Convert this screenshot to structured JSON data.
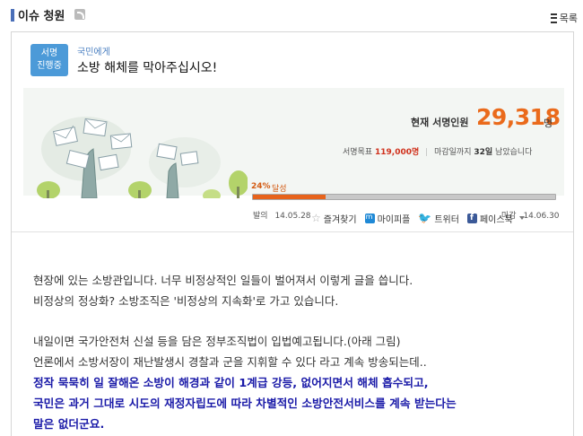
{
  "header": {
    "title": "이슈 청원",
    "rss_icon": "rss-icon",
    "list_label": "목록"
  },
  "petition": {
    "status_line1": "서명",
    "status_line2": "진행중",
    "to": "국민에게",
    "title": "소방 해체를 막아주십시오!"
  },
  "stats": {
    "current_label": "현재 서명인원",
    "current_count": "29,318",
    "current_unit": "명",
    "goal_label": "서명목표",
    "goal_value": "119,000명",
    "deadline_label": "마감일까지",
    "deadline_days": "32일",
    "deadline_suffix": "남았습니다",
    "progress_text": "24%",
    "progress_suffix": "달성",
    "progress_value": 24,
    "start_label": "발의",
    "start_date": "14.05.28",
    "end_label": "마감",
    "end_date": "14.06.30",
    "accent_color": "#e7631b"
  },
  "share": {
    "bookmark": "즐겨찾기",
    "me2day": "마이피플",
    "twitter": "트위터",
    "facebook": "페이스북"
  },
  "content": {
    "lines": [
      "현장에 있는 소방관입니다. 너무 비정상적인 일들이 벌어져서 이렇게 글을 씁니다.",
      "비정상의 정상화? 소방조직은 '비정상의 지속화'로 가고 있습니다.",
      "",
      "내일이면 국가안전처 신설 등을 담은 정부조직법이 입법예고됩니다.(아래 그림)",
      "언론에서 소방서장이 재난발생시 경찰과 군을 지휘할 수 있다 라고 계속 방송되는데..",
      "정작 묵묵히 일 잘해온 소방이 해경과 같이 1계급 강등, 없어지면서 해체 흡수되고,",
      "국민은 과거 그대로 시도의 재정자립도에 따라 차별적인 소방안전서비스를 계속 받는다는",
      "말은 없더군요."
    ]
  }
}
